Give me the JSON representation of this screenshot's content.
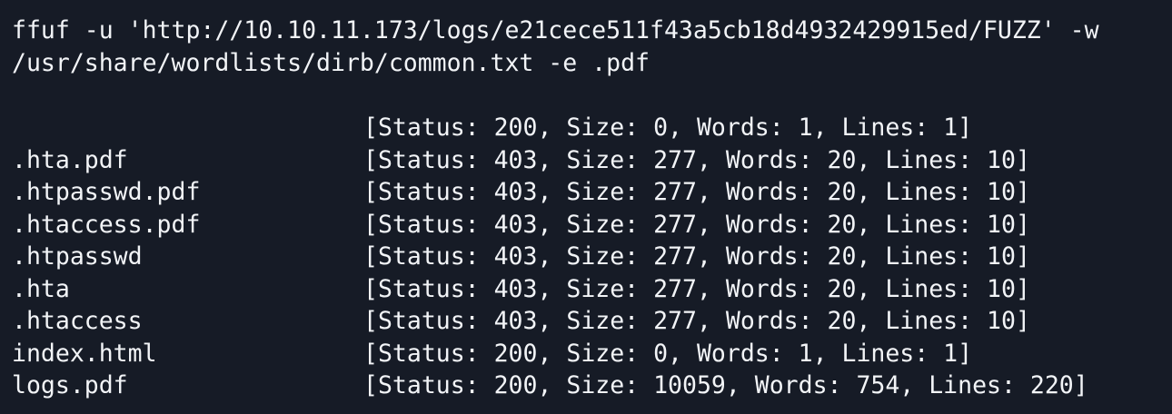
{
  "terminal": {
    "command_line_1": "ffuf -u 'http://10.10.11.173/logs/e21cece511f43a5cb18d4932429915ed/FUZZ' -w",
    "command_line_2": "/usr/share/wordlists/dirb/common.txt -e .pdf",
    "results": [
      {
        "path": "",
        "info": "[Status: 200, Size: 0, Words: 1, Lines: 1]"
      },
      {
        "path": ".hta.pdf",
        "info": "[Status: 403, Size: 277, Words: 20, Lines: 10]"
      },
      {
        "path": ".htpasswd.pdf",
        "info": "[Status: 403, Size: 277, Words: 20, Lines: 10]"
      },
      {
        "path": ".htaccess.pdf",
        "info": "[Status: 403, Size: 277, Words: 20, Lines: 10]"
      },
      {
        "path": ".htpasswd",
        "info": "[Status: 403, Size: 277, Words: 20, Lines: 10]"
      },
      {
        "path": ".hta",
        "info": "[Status: 403, Size: 277, Words: 20, Lines: 10]"
      },
      {
        "path": ".htaccess",
        "info": "[Status: 403, Size: 277, Words: 20, Lines: 10]"
      },
      {
        "path": "index.html",
        "info": "[Status: 200, Size: 0, Words: 1, Lines: 1]"
      },
      {
        "path": "logs.pdf",
        "info": "[Status: 200, Size: 10059, Words: 754, Lines: 220]"
      }
    ]
  },
  "colors": {
    "background": "#161b26",
    "text": "#f2f4f7"
  }
}
